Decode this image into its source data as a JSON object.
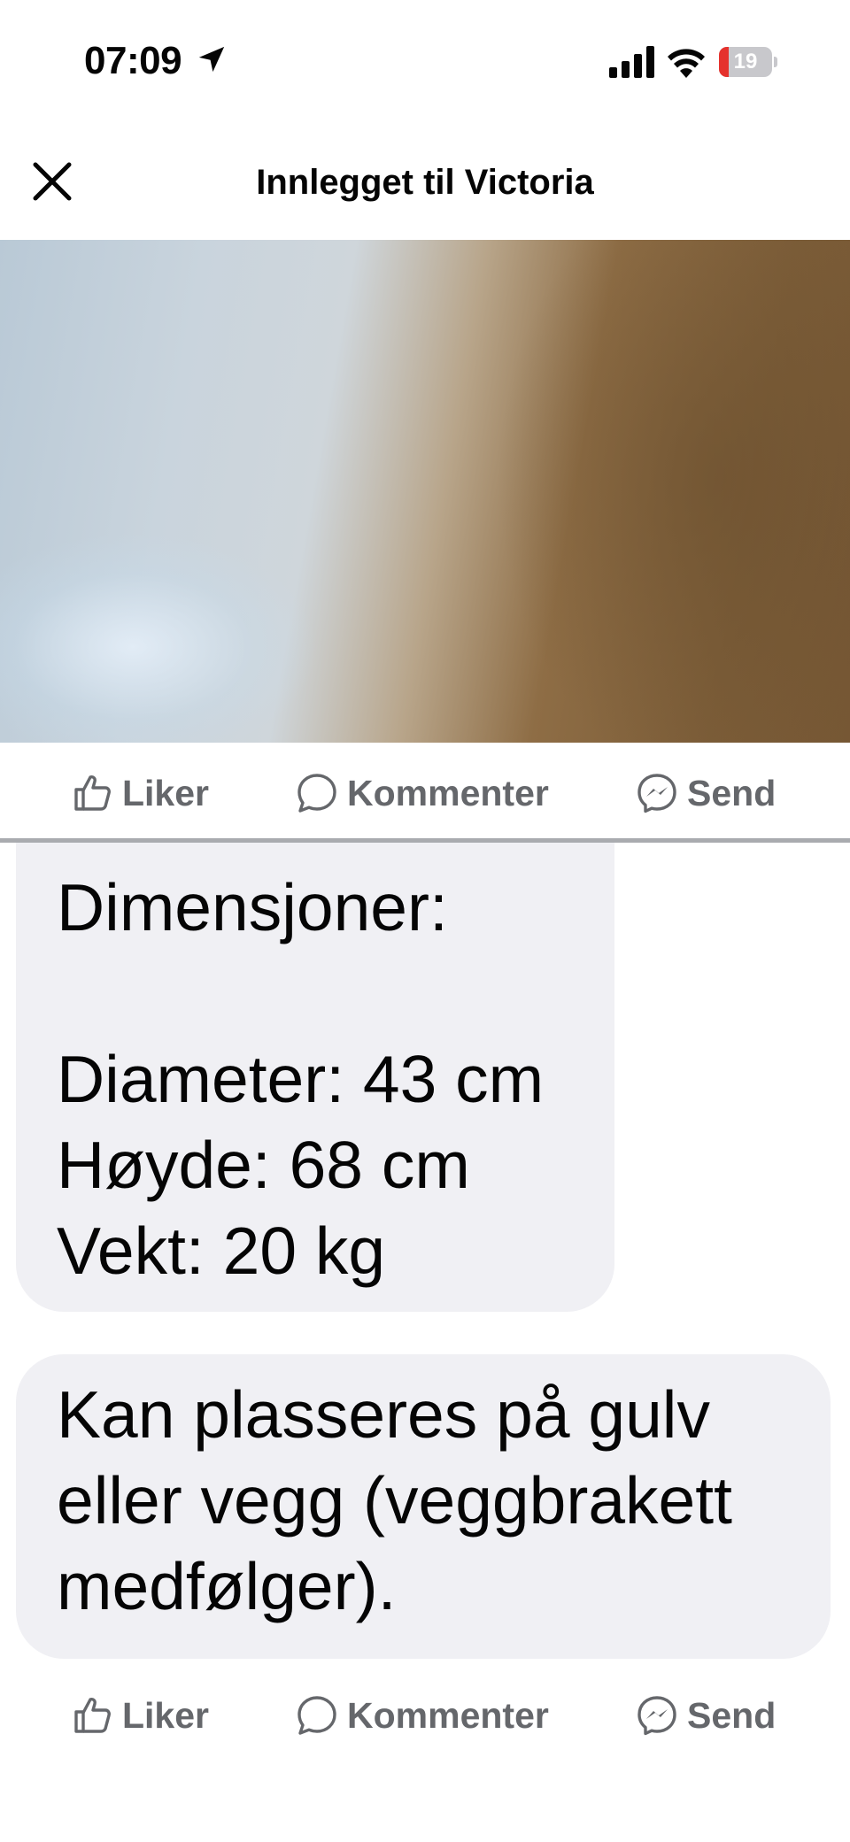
{
  "status_bar": {
    "time": "07:09",
    "battery_level": "19",
    "battery_fraction": 0.19,
    "icons": [
      "location-arrow-icon",
      "cellular-signal-icon",
      "wifi-icon",
      "battery-icon"
    ]
  },
  "header": {
    "title": "Innlegget til Victoria",
    "close_icon": "close-icon"
  },
  "actions": {
    "like_label": "Liker",
    "comment_label": "Kommenter",
    "send_label": "Send"
  },
  "messages": [
    {
      "lines": [
        "Dimensjoner:",
        "",
        "Diameter: 43 cm",
        "Høyde: 68 cm",
        "Vekt: 20 kg"
      ]
    },
    {
      "lines": [
        "Kan plasseres på gulv",
        "eller vegg (veggbrakett",
        "medfølger)."
      ]
    }
  ],
  "colors": {
    "action_text": "#65676b",
    "bubble_background": "#f0f0f4",
    "battery_low": "#e5322d"
  }
}
